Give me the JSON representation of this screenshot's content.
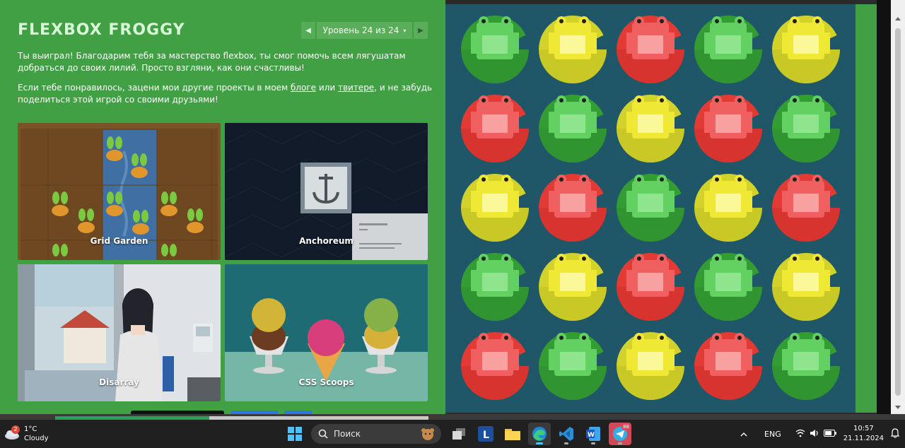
{
  "app": {
    "brand": "FLEXBOX FROGGY",
    "level_label": "Уровень 24 из 24",
    "prev_icon": "triangle-left",
    "next_icon": "triangle-right",
    "caret": "▾"
  },
  "text": {
    "p1": "Ты выиграл! Благодарим тебя за мастерство flexbox, ты смог помочь всем лягушатам добраться до своих лилий. Просто взгляни, как они счастливы!",
    "p2_before": "Если тебе понравилось, зацени мои другие проекты в моем ",
    "p2_link1": "блоге",
    "p2_mid": " или ",
    "p2_link2": "твитере",
    "p2_after": ", и не забудь поделиться этой игрой со своими друзьями!"
  },
  "projects": [
    {
      "label": "Grid Garden"
    },
    {
      "label": "Anchoreum"
    },
    {
      "label": "Disarray"
    },
    {
      "label": "CSS Scoops"
    }
  ],
  "colors": {
    "green_bg": "#42a044",
    "pond": "#1f5768",
    "green_pad": "#339c33",
    "green_frog": "#62d161",
    "yellow_pad": "#d2d22b",
    "yellow_frog": "#efe936",
    "red_pad": "#e23a35",
    "red_frog": "#f06060"
  },
  "board": [
    [
      "green",
      "yellow",
      "red",
      "green",
      "yellow"
    ],
    [
      "red",
      "green",
      "yellow",
      "red",
      "green"
    ],
    [
      "yellow",
      "red",
      "green",
      "yellow",
      "red"
    ],
    [
      "green",
      "yellow",
      "red",
      "green",
      "yellow"
    ],
    [
      "red",
      "green",
      "yellow",
      "red",
      "green"
    ]
  ],
  "taskbar": {
    "weather_badge": "2",
    "temperature": "1°C",
    "weather": "Cloudy",
    "search_placeholder": "Поиск",
    "language": "ENG",
    "time": "10:57",
    "date": "21.11.2024",
    "telegram_badge": "88"
  }
}
